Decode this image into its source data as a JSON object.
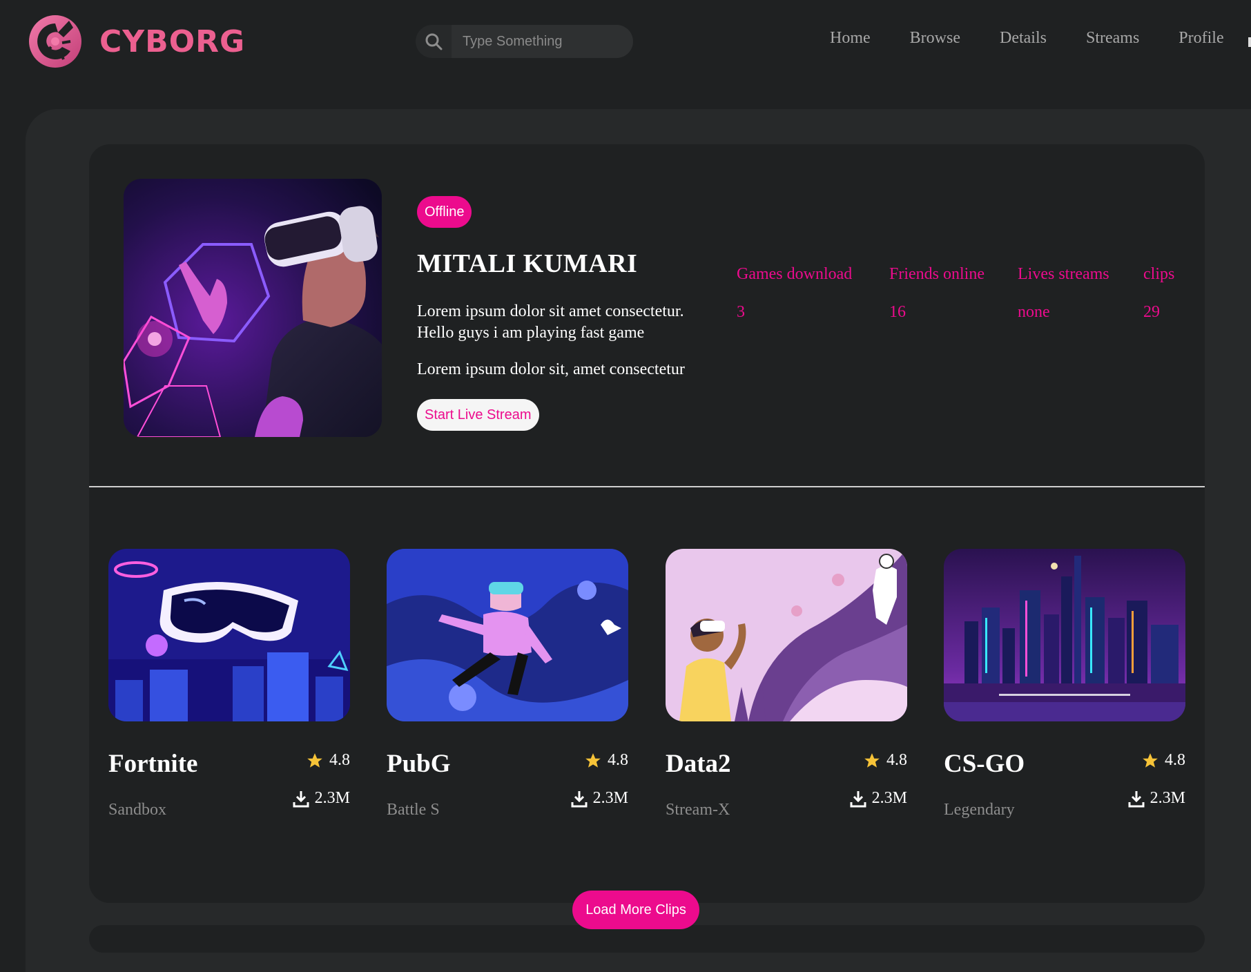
{
  "brand": {
    "name": "CYBORG",
    "accent": "#ec0b8d",
    "logo_color": "#ec6090"
  },
  "search": {
    "placeholder": "Type Something",
    "value": ""
  },
  "nav": {
    "items": [
      "Home",
      "Browse",
      "Details",
      "Streams",
      "Profile"
    ]
  },
  "profile": {
    "status": "Offline",
    "name": "MITALI KUMARI",
    "description": "Lorem ipsum dolor sit amet consectetur. Hello guys i am playing fast game",
    "description2": "Lorem ipsum dolor sit, amet consectetur",
    "cta": "Start Live Stream",
    "stats": [
      {
        "label": "Games download",
        "value": "3"
      },
      {
        "label": "Friends online",
        "value": "16"
      },
      {
        "label": "Lives streams",
        "value": "none"
      },
      {
        "label": "clips",
        "value": "29"
      }
    ]
  },
  "clips": [
    {
      "title": "Fortnite",
      "genre": "Sandbox",
      "rating": "4.8",
      "downloads": "2.3M",
      "image": "vr-headset-city-art"
    },
    {
      "title": "PubG",
      "genre": "Battle S",
      "rating": "4.8",
      "downloads": "2.3M",
      "image": "floating-vr-character-art"
    },
    {
      "title": "Data2",
      "genre": "Stream-X",
      "rating": "4.8",
      "downloads": "2.3M",
      "image": "vr-space-astronaut-art"
    },
    {
      "title": "CS-GO",
      "genre": "Legendary",
      "rating": "4.8",
      "downloads": "2.3M",
      "image": "neon-city-skyline-art"
    }
  ],
  "load_more": "Load More Clips",
  "icons": {
    "search": "search-icon",
    "star": "star-icon",
    "download": "download-icon",
    "star_color": "#f6c338"
  }
}
